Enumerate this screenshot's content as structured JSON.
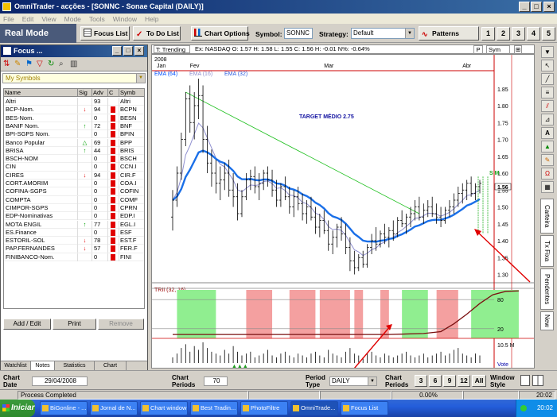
{
  "window": {
    "title": "OmniTrader - acções - [SONNC - Sonae Capital (DAILY)]",
    "controls": [
      "_",
      "□",
      "×"
    ]
  },
  "menu": [
    "File",
    "Edit",
    "View",
    "Mode",
    "Tools",
    "Window",
    "Help"
  ],
  "toolbar": {
    "mode": "Real Mode",
    "focus_list": "Focus List",
    "to_do_list": "To Do List",
    "chart_options": "Chart Options",
    "symbol_label": "Symbol:",
    "symbol_value": "SONNC",
    "strategy_label": "Strategy:",
    "strategy_value": "Default",
    "patterns": "Patterns",
    "layouts": [
      "1",
      "2",
      "3",
      "4",
      "5"
    ]
  },
  "focus": {
    "title": "Focus ...",
    "list_name": "My Symbols",
    "columns": [
      "Name",
      "Sig",
      "Adv",
      "C",
      "Symb"
    ],
    "rows": [
      {
        "name": "Altri",
        "sig": "",
        "adv": "93",
        "c": "",
        "sym": "Altri"
      },
      {
        "name": "BCP-Nom.",
        "sig": "down",
        "adv": "94",
        "c": "red",
        "sym": "BCPN"
      },
      {
        "name": "BES-Nom.",
        "sig": "",
        "adv": "0",
        "c": "red",
        "sym": "BESN"
      },
      {
        "name": "BANIF Nom.",
        "sig": "up",
        "adv": "72",
        "c": "red",
        "sym": "BNF"
      },
      {
        "name": "BPI-SGPS Nom.",
        "sig": "",
        "adv": "0",
        "c": "red",
        "sym": "BPIN"
      },
      {
        "name": "Banco Popular",
        "sig": "tri",
        "adv": "69",
        "c": "red",
        "sym": "BPP"
      },
      {
        "name": "BRISA",
        "sig": "up",
        "adv": "44",
        "c": "red",
        "sym": "BRIS"
      },
      {
        "name": "BSCH-NOM",
        "sig": "",
        "adv": "0",
        "c": "red",
        "sym": "BSCH"
      },
      {
        "name": "CIN",
        "sig": "",
        "adv": "0",
        "c": "red",
        "sym": "CCN.I"
      },
      {
        "name": "CIRES",
        "sig": "down",
        "adv": "94",
        "c": "red",
        "sym": "CIR.F"
      },
      {
        "name": "CORT.AMORIM",
        "sig": "",
        "adv": "0",
        "c": "red",
        "sym": "COA.I"
      },
      {
        "name": "COFINA-SGPS",
        "sig": "",
        "adv": "0",
        "c": "red",
        "sym": "COFIN"
      },
      {
        "name": "COMPTA",
        "sig": "",
        "adv": "0",
        "c": "red",
        "sym": "COMF"
      },
      {
        "name": "CIMPOR-SGPS",
        "sig": "",
        "adv": "0",
        "c": "red",
        "sym": "CPRN"
      },
      {
        "name": "EDP-Nominativas",
        "sig": "",
        "adv": "0",
        "c": "red",
        "sym": "EDP.I"
      },
      {
        "name": "MOTA ENGIL",
        "sig": "up",
        "adv": "77",
        "c": "red",
        "sym": "EGL.I"
      },
      {
        "name": "ES.Finance",
        "sig": "",
        "adv": "0",
        "c": "red",
        "sym": "ESF"
      },
      {
        "name": "ESTORIL-SOL",
        "sig": "down",
        "adv": "78",
        "c": "red",
        "sym": "EST.F"
      },
      {
        "name": "PAP.FERNANDES",
        "sig": "down",
        "adv": "57",
        "c": "red",
        "sym": "FER.F"
      },
      {
        "name": "FINIBANCO-Nom.",
        "sig": "",
        "adv": "0",
        "c": "red",
        "sym": "FINI"
      }
    ],
    "buttons": {
      "add_edit": "Add / Edit",
      "print": "Print",
      "remove": "Remove"
    },
    "tabs": [
      "Watchlist",
      "Notes",
      "Statistics",
      "Chart"
    ]
  },
  "chart_header": {
    "mode": "T: Trending",
    "info": "Ex: NASDAQ  O: 1.57  H: 1.58  L: 1.55  C: 1.56  H: -0.01  N%: -0.64%",
    "pair": "P",
    "sym": "Sym",
    "year": "2008"
  },
  "chart_data": {
    "type": "line",
    "title": "TARGET MÉDIO 2.75",
    "months": [
      {
        "label": "Jan",
        "at": 0
      },
      {
        "label": "Fev",
        "at": 4
      },
      {
        "label": "Mar",
        "at": 35
      },
      {
        "label": "Abr",
        "at": 67
      }
    ],
    "ema_legend": [
      "EMA (64)",
      "EMA (16)",
      "EMA (32)"
    ],
    "price_ticks": [
      1.3,
      1.35,
      1.4,
      1.45,
      1.5,
      1.55,
      1.6,
      1.65,
      1.7,
      1.75,
      1.8,
      1.85
    ],
    "ylim": [
      1.28,
      1.88
    ],
    "highlight_price": "1.56",
    "ohlc": [
      [
        1.47,
        1.55,
        1.43,
        1.52
      ],
      [
        1.52,
        1.62,
        1.5,
        1.6
      ],
      [
        1.6,
        1.72,
        1.58,
        1.7
      ],
      [
        1.7,
        1.84,
        1.68,
        1.82
      ],
      [
        1.82,
        1.86,
        1.72,
        1.75
      ],
      [
        1.75,
        1.84,
        1.7,
        1.8
      ],
      [
        1.8,
        1.88,
        1.76,
        1.83
      ],
      [
        1.83,
        1.86,
        1.66,
        1.7
      ],
      [
        1.7,
        1.74,
        1.6,
        1.63
      ],
      [
        1.63,
        1.67,
        1.56,
        1.6
      ],
      [
        1.6,
        1.64,
        1.54,
        1.57
      ],
      [
        1.57,
        1.62,
        1.52,
        1.58
      ],
      [
        1.58,
        1.63,
        1.55,
        1.6
      ],
      [
        1.6,
        1.64,
        1.53,
        1.55
      ],
      [
        1.55,
        1.6,
        1.5,
        1.53
      ],
      [
        1.53,
        1.57,
        1.46,
        1.48
      ],
      [
        1.48,
        1.55,
        1.47,
        1.53
      ],
      [
        1.53,
        1.6,
        1.52,
        1.58
      ],
      [
        1.58,
        1.61,
        1.55,
        1.59
      ],
      [
        1.59,
        1.62,
        1.54,
        1.56
      ],
      [
        1.56,
        1.6,
        1.52,
        1.57
      ],
      [
        1.57,
        1.61,
        1.55,
        1.6
      ],
      [
        1.6,
        1.62,
        1.56,
        1.58
      ],
      [
        1.58,
        1.61,
        1.53,
        1.55
      ],
      [
        1.55,
        1.58,
        1.5,
        1.52
      ],
      [
        1.52,
        1.57,
        1.5,
        1.56
      ],
      [
        1.56,
        1.59,
        1.52,
        1.53
      ],
      [
        1.53,
        1.56,
        1.48,
        1.5
      ],
      [
        1.5,
        1.55,
        1.47,
        1.53
      ],
      [
        1.53,
        1.56,
        1.49,
        1.51
      ],
      [
        1.51,
        1.54,
        1.46,
        1.48
      ],
      [
        1.48,
        1.52,
        1.45,
        1.5
      ],
      [
        1.5,
        1.53,
        1.46,
        1.47
      ],
      [
        1.47,
        1.5,
        1.42,
        1.44
      ],
      [
        1.44,
        1.48,
        1.41,
        1.46
      ],
      [
        1.46,
        1.49,
        1.42,
        1.43
      ],
      [
        1.43,
        1.46,
        1.37,
        1.39
      ],
      [
        1.39,
        1.43,
        1.36,
        1.41
      ],
      [
        1.41,
        1.45,
        1.38,
        1.44
      ],
      [
        1.44,
        1.47,
        1.4,
        1.42
      ],
      [
        1.42,
        1.45,
        1.36,
        1.38
      ],
      [
        1.38,
        1.41,
        1.31,
        1.34
      ],
      [
        1.34,
        1.37,
        1.3,
        1.32
      ],
      [
        1.32,
        1.36,
        1.31,
        1.35
      ],
      [
        1.35,
        1.37,
        1.32,
        1.33
      ],
      [
        1.33,
        1.39,
        1.32,
        1.38
      ],
      [
        1.38,
        1.42,
        1.36,
        1.4
      ],
      [
        1.4,
        1.44,
        1.37,
        1.39
      ],
      [
        1.39,
        1.43,
        1.38,
        1.42
      ],
      [
        1.42,
        1.45,
        1.39,
        1.41
      ],
      [
        1.41,
        1.44,
        1.38,
        1.43
      ],
      [
        1.43,
        1.46,
        1.4,
        1.42
      ],
      [
        1.42,
        1.47,
        1.41,
        1.46
      ],
      [
        1.46,
        1.49,
        1.44,
        1.45
      ],
      [
        1.45,
        1.48,
        1.42,
        1.47
      ],
      [
        1.47,
        1.5,
        1.44,
        1.48
      ],
      [
        1.48,
        1.52,
        1.46,
        1.5
      ],
      [
        1.5,
        1.53,
        1.46,
        1.47
      ],
      [
        1.47,
        1.51,
        1.45,
        1.49
      ],
      [
        1.49,
        1.52,
        1.47,
        1.5
      ],
      [
        1.5,
        1.53,
        1.47,
        1.48
      ],
      [
        1.48,
        1.51,
        1.45,
        1.47
      ],
      [
        1.47,
        1.5,
        1.44,
        1.46
      ],
      [
        1.46,
        1.5,
        1.45,
        1.49
      ],
      [
        1.49,
        1.52,
        1.47,
        1.5
      ],
      [
        1.5,
        1.54,
        1.48,
        1.52
      ],
      [
        1.52,
        1.56,
        1.5,
        1.54
      ],
      [
        1.54,
        1.57,
        1.51,
        1.55
      ],
      [
        1.55,
        1.58,
        1.52,
        1.57
      ],
      [
        1.57,
        1.59,
        1.53,
        1.54
      ],
      [
        1.54,
        1.57,
        1.52,
        1.56
      ],
      [
        1.56,
        1.58,
        1.54,
        1.57
      ]
    ],
    "trendline": {
      "from": [
        3,
        1.84
      ],
      "to": [
        57,
        1.48
      ]
    },
    "markers_sm": {
      "label": "S M"
    },
    "indicator": {
      "name": "TRII (32, 16)",
      "levels": [
        80,
        20
      ],
      "ylim": [
        0,
        100
      ],
      "zones": [
        {
          "from": 1,
          "to": 10,
          "color": "#90ee90"
        },
        {
          "from": 17,
          "to": 23,
          "color": "#f4a0a0"
        },
        {
          "from": 27,
          "to": 33,
          "color": "#f4a0a0"
        },
        {
          "from": 34,
          "to": 41,
          "color": "#f4a0a0"
        },
        {
          "from": 42,
          "to": 44,
          "color": "#f4a0a0"
        },
        {
          "from": 48,
          "to": 50,
          "color": "#f4a0a0"
        },
        {
          "from": 53,
          "to": 59,
          "color": "#90ee90"
        },
        {
          "from": 61,
          "to": 66,
          "color": "#f4a0a0"
        },
        {
          "from": 69,
          "to": 80,
          "color": "#90ee90"
        }
      ],
      "line": [
        [
          0,
          8
        ],
        [
          30,
          8
        ],
        [
          50,
          8
        ],
        [
          58,
          10
        ],
        [
          62,
          14
        ],
        [
          65,
          30
        ],
        [
          68,
          50
        ],
        [
          71,
          72
        ],
        [
          74,
          90
        ],
        [
          77,
          97
        ],
        [
          80,
          98
        ]
      ]
    },
    "volume": {
      "label": "10.5 M",
      "values": [
        3,
        5,
        8,
        10,
        6,
        9,
        7,
        11,
        8,
        6,
        5,
        4,
        7,
        5,
        9,
        6,
        4,
        5,
        6,
        3,
        4,
        5,
        7,
        4,
        3,
        5,
        6,
        4,
        3,
        5,
        4,
        3,
        5,
        6,
        4,
        3,
        7,
        5,
        4,
        3,
        6,
        8,
        5,
        4,
        3,
        5,
        6,
        4,
        3,
        5,
        4,
        3,
        4,
        5,
        6,
        4,
        3,
        4,
        5,
        3,
        4,
        5,
        6,
        4,
        5,
        7,
        8,
        5,
        4,
        3,
        5,
        4
      ]
    },
    "vote_label": "Vote"
  },
  "right_tabs": [
    "Carteira",
    "Tx Fixa",
    "Pendentes",
    "New"
  ],
  "bottom": {
    "chart_date_label": "Chart Date",
    "chart_date_value": "29/04/2008",
    "chart_periods_label": "Chart Periods",
    "chart_periods_value": "70",
    "period_type_label": "Period Type",
    "period_type_value": "DAILY",
    "chart_periods2_label": "Chart Periods",
    "period_buttons": [
      "3",
      "6",
      "9",
      "12",
      "All"
    ],
    "window_style_label": "Window Style"
  },
  "status": {
    "left": "Process Completed",
    "pct": "0.00%",
    "time": "20:02"
  },
  "taskbar": {
    "start": "Iniciar",
    "tasks": [
      "BiGonline - ...",
      "Jornal de N...",
      "Chart window",
      "Best Tradin...",
      "PhotoFiltre",
      "OmniTrade...",
      "Focus List"
    ],
    "clock": "20:02"
  }
}
